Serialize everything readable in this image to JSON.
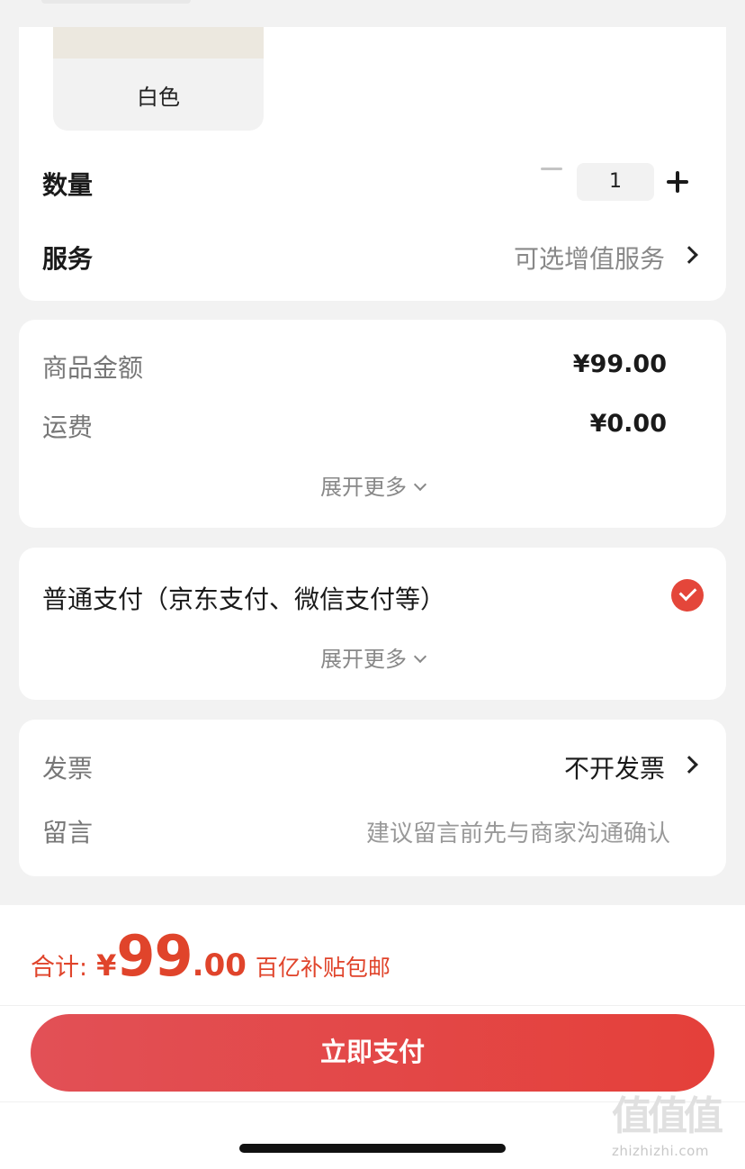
{
  "spec": {
    "variant_label": "白色",
    "quantity_label": "数量",
    "quantity_value": "1",
    "service_label": "服务",
    "service_value": "可选增值服务"
  },
  "price": {
    "goods_label": "商品金额",
    "goods_amount": "¥99.00",
    "shipping_label": "运费",
    "shipping_amount": "¥0.00",
    "expand_label": "展开更多"
  },
  "payment": {
    "method_label": "普通支付（京东支付、微信支付等）",
    "expand_label": "展开更多"
  },
  "invoice": {
    "invoice_label": "发票",
    "invoice_value": "不开发票",
    "note_label": "留言",
    "note_placeholder": "建议留言前先与商家沟通确认"
  },
  "footer": {
    "total_label": "合计:",
    "currency": "¥",
    "total_int": "99",
    "total_dec": ".00",
    "subsidy_text": "百亿补贴包邮",
    "pay_button": "立即支付"
  },
  "watermark": {
    "logo": "值值值",
    "site": "zhizhizhi.com"
  },
  "colors": {
    "accent": "#e4463a",
    "background": "#f2f2f2",
    "card": "#ffffff"
  }
}
